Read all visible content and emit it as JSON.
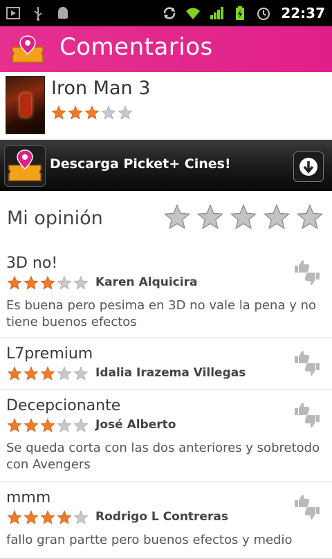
{
  "status_bar": {
    "left_icons": [
      "media-icon",
      "usb-icon",
      "android-debug-icon"
    ],
    "right_icons": [
      "sync-icon",
      "wifi-icon",
      "signal-icon",
      "battery-charging-icon",
      "alarm-icon"
    ],
    "time": "22:37"
  },
  "header": {
    "title": "Comentarios",
    "logo_icon": "picket-ticket-icon"
  },
  "movie": {
    "title": "Iron Man 3",
    "rating": 3,
    "rating_max": 5
  },
  "ad": {
    "text": "Descarga Picket+ Cines!",
    "download_icon": "download-icon"
  },
  "opinion": {
    "label": "Mi opinión",
    "rating": 0,
    "rating_max": 5
  },
  "reviews": [
    {
      "title": "3D no!",
      "rating": 3,
      "author": "Karen Alquicira",
      "text": "Es buena pero pesima en 3D no vale la pena y no tiene buenos efectos"
    },
    {
      "title": "L7premium",
      "rating": 3,
      "author": "Idalia Irazema Villegas",
      "text": ""
    },
    {
      "title": "Decepcionante",
      "rating": 3,
      "author": "José Alberto",
      "text": "Se queda corta con las dos anteriores y sobretodo con Avengers"
    },
    {
      "title": "mmm",
      "rating": 4,
      "author": "Rodrigo L Contreras",
      "text": "fallo gran partte pero buenos efectos y medio"
    }
  ],
  "colors": {
    "accent": "#e0208a",
    "star_filled": "#f07a2a",
    "star_empty": "#c8c8c8"
  }
}
